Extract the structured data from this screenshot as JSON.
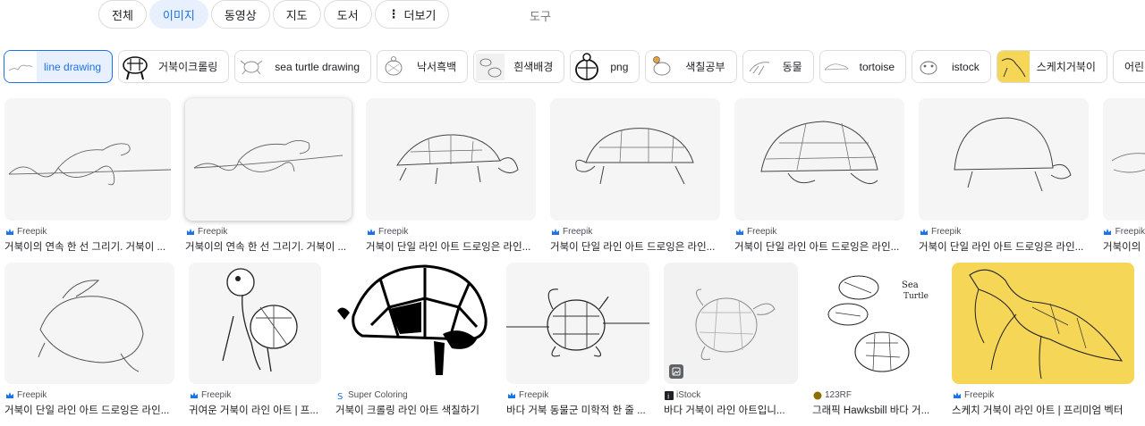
{
  "tabs": [
    {
      "label": "전체"
    },
    {
      "label": "이미지"
    },
    {
      "label": "동영상"
    },
    {
      "label": "지도"
    },
    {
      "label": "도서"
    },
    {
      "label": "더보기"
    }
  ],
  "tools_label": "도구",
  "chips": [
    {
      "label": "line drawing"
    },
    {
      "label": "거북이크롤링"
    },
    {
      "label": "sea turtle drawing"
    },
    {
      "label": "낙서흑백"
    },
    {
      "label": "흰색배경"
    },
    {
      "label": "png"
    },
    {
      "label": "색칠공부"
    },
    {
      "label": "동물"
    },
    {
      "label": "tortoise"
    },
    {
      "label": "istock"
    },
    {
      "label": "스케치거북이"
    },
    {
      "label": "어린이색칠"
    }
  ],
  "row1": [
    {
      "source": "Freepik",
      "caption": "거북이의 연속 한 선 그리기. 거북이 ..."
    },
    {
      "source": "Freepik",
      "caption": "거북이의 연속 한 선 그리기. 거북이 ..."
    },
    {
      "source": "Freepik",
      "caption": "거북이 단일 라인 아트 드로잉은 라인..."
    },
    {
      "source": "Freepik",
      "caption": "거북이 단일 라인 아트 드로잉은 라인..."
    },
    {
      "source": "Freepik",
      "caption": "거북이 단일 라인 아트 드로잉은 라인..."
    },
    {
      "source": "Freepik",
      "caption": "거북이 단일 라인 아트 드로잉은 라인..."
    },
    {
      "source": "Freepik",
      "caption": "거북이의"
    }
  ],
  "row2": [
    {
      "source": "Freepik",
      "caption": "거북이 단일 라인 아트 드로잉은 라인..."
    },
    {
      "source": "Freepik",
      "caption": "귀여운 거북이 라인 아트 | 프..."
    },
    {
      "source": "Super Coloring",
      "caption": "거북이 크롤링 라인 아트 색칠하기"
    },
    {
      "source": "Freepik",
      "caption": "바다 거북 동물군 미학적 한 줄 ..."
    },
    {
      "source": "iStock",
      "caption": "바다 거북이 라인 아트입니..."
    },
    {
      "source": "123RF",
      "caption": "그래픽 Hawksbill 바다 거..."
    },
    {
      "source": "Freepik",
      "caption": "스케치 거북이 라인 아트 | 프리미엄 벡터"
    }
  ],
  "colors": {
    "accent": "#1a73e8",
    "active_bg": "#e8f0fe",
    "chip_yellow": "#f5d657",
    "card_yellow": "#f5d657"
  },
  "icons": [
    "more-vert-icon",
    "freepik-crown-icon",
    "super-coloring-icon",
    "istock-icon",
    "123rf-icon",
    "image-badge-icon"
  ]
}
